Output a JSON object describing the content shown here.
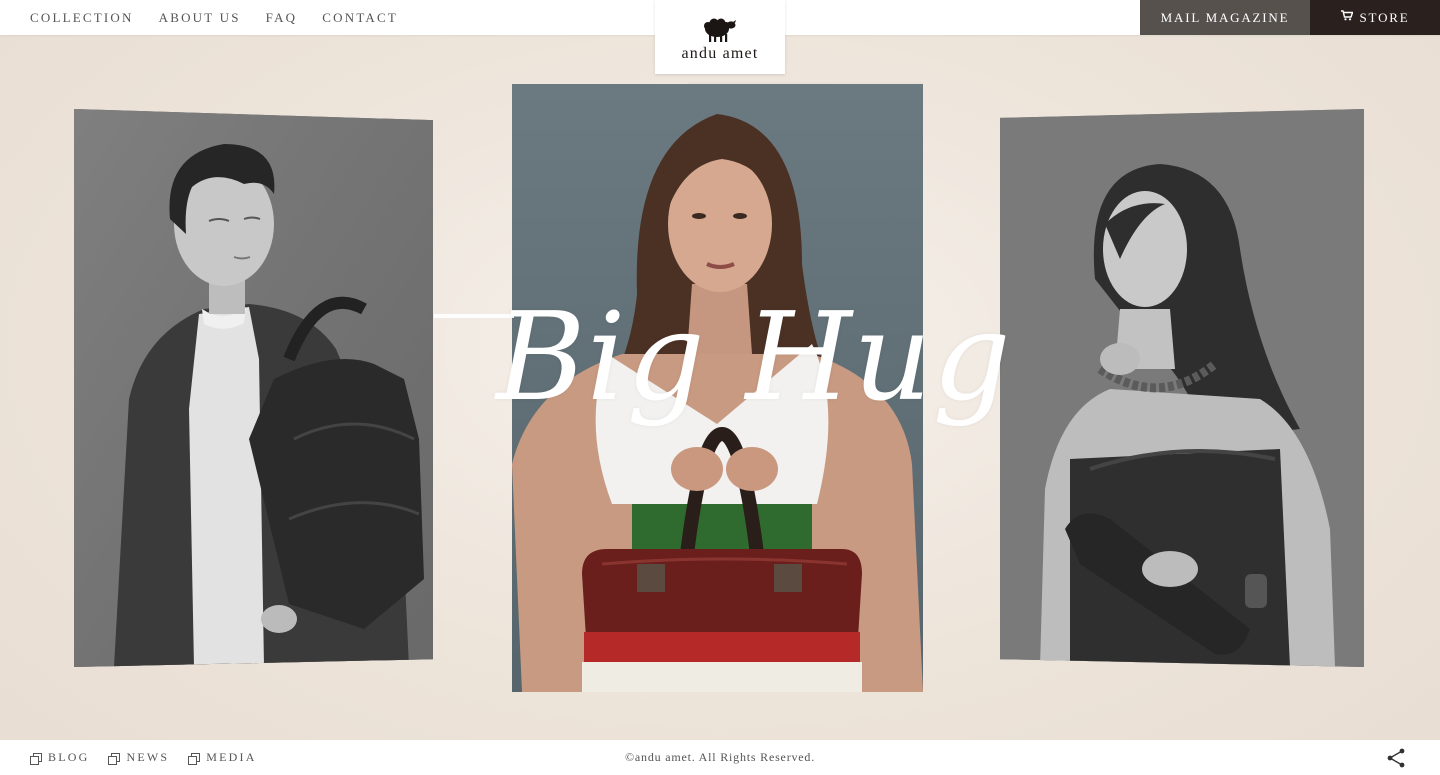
{
  "header": {
    "nav": [
      {
        "label": "COLLECTION"
      },
      {
        "label": "ABOUT US"
      },
      {
        "label": "FAQ"
      },
      {
        "label": "CONTACT"
      }
    ],
    "logo_text": "andu amet",
    "logo_icon": "sheep-icon",
    "mail_label": "MAIL MAGAZINE",
    "store_label": "STORE",
    "store_icon": "cart-icon"
  },
  "hero": {
    "headline": "Big Hug",
    "photos": [
      {
        "name": "photo-man-with-bag",
        "tone": "monochrome"
      },
      {
        "name": "photo-woman-with-red-bag",
        "tone": "color"
      },
      {
        "name": "photo-woman-with-clutch",
        "tone": "monochrome"
      }
    ]
  },
  "footer": {
    "links": [
      {
        "label": "BLOG",
        "icon": "copy-square-icon"
      },
      {
        "label": "NEWS",
        "icon": "copy-square-icon"
      },
      {
        "label": "MEDIA",
        "icon": "copy-square-icon"
      }
    ],
    "copyright": "©andu amet. All Rights Reserved.",
    "share_icon": "share-icon"
  },
  "colors": {
    "background": "#ede4da",
    "mail_button": "#57514e",
    "store_button": "#2a201e",
    "headline": "#ffffff"
  }
}
